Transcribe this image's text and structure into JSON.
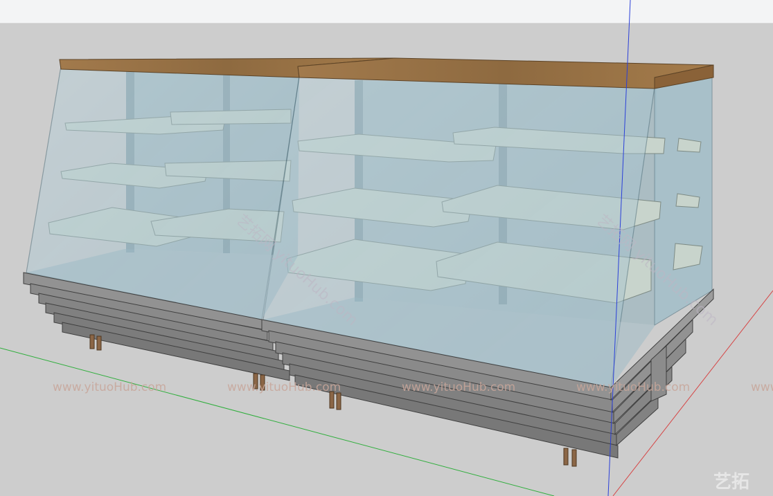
{
  "viewport": {
    "background_color": "#cdcdcd",
    "toolbar_color": "#f3f4f5"
  },
  "model": {
    "subject": "display-case",
    "counter_top_color": "#9a7447",
    "glass_color": "#a9c7d3",
    "shelf_color": "#c8d4cc",
    "base_color": "#8a8a8a",
    "leg_color": "#8b6646"
  },
  "axes": {
    "red_axis_color": "#d64545",
    "green_axis_color": "#2fae3c",
    "blue_axis_color": "#2a3fd9"
  },
  "watermarks": {
    "text": "www.yituoHub.com",
    "diagonal_text": "艺拓网 yituoHub.com",
    "logo": "艺拓"
  }
}
